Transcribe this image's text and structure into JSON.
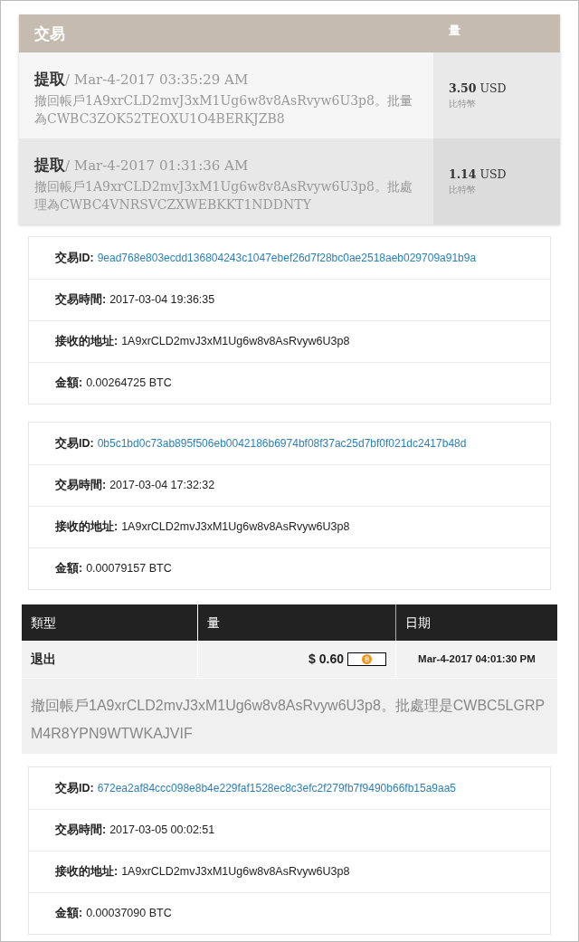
{
  "summary": {
    "columns": [
      "交易",
      "量"
    ],
    "rows": [
      {
        "type": "提取",
        "date": "/ Mar-4-2017 03:35:29 AM",
        "description": "撤回帳戶1A9xrCLD2mvJ3xM1Ug6w8v8AsRvyw6U3p8。批量為CWBC3ZOK52TEOXU1O4BERKJZB8",
        "amount": "3.50",
        "currency": "USD",
        "unit": "比特幣",
        "shaded": false
      },
      {
        "type": "提取",
        "date": "/ Mar-4-2017 01:31:36 AM",
        "description": "撤回帳戶1A9xrCLD2mvJ3xM1Ug6w8v8AsRvyw6U3p8。批處理為CWBC4VNRSVCZXWEBKKT1NDDNTY",
        "amount": "1.14",
        "currency": "USD",
        "unit": "比特幣",
        "shaded": true
      }
    ]
  },
  "details_1": [
    {
      "fields": [
        {
          "label": "交易ID:",
          "value": "9ead768e803ecdd136804243c1047ebef26d7f28bc0ae2518aeb029709a91b9a",
          "kind": "link"
        },
        {
          "label": "交易時間:",
          "value": "2017-03-04 19:36:35",
          "kind": "text"
        },
        {
          "label": "接收的地址:",
          "value": "1A9xrCLD2mvJ3xM1Ug6w8v8AsRvyw6U3p8",
          "kind": "text"
        },
        {
          "label": "金額:",
          "value": "0.00264725 BTC",
          "kind": "text"
        }
      ]
    },
    {
      "fields": [
        {
          "label": "交易ID:",
          "value": "0b5c1bd0c73ab895f506eb0042186b6974bf08f37ac25d7bf0f021dc2417b48d",
          "kind": "link"
        },
        {
          "label": "交易時間:",
          "value": "2017-03-04 17:32:32",
          "kind": "text"
        },
        {
          "label": "接收的地址:",
          "value": "1A9xrCLD2mvJ3xM1Ug6w8v8AsRvyw6U3p8",
          "kind": "text"
        },
        {
          "label": "金額:",
          "value": "0.00079157 BTC",
          "kind": "text"
        }
      ]
    }
  ],
  "table": {
    "columns": [
      "類型",
      "量",
      "日期"
    ],
    "rows": [
      {
        "type": "退出",
        "amount": "$ 0.60",
        "date": "Mar-4-2017 04:01:30 PM",
        "description": "撤回帳戶1A9xrCLD2mvJ3xM1Ug6w8v8AsRvyw6U3p8。批處理是CWBC5LGRPM4R8YPN9WTWKAJVIF"
      }
    ]
  },
  "details_2": [
    {
      "fields": [
        {
          "label": "交易ID:",
          "value": "672ea2af84ccc098e8b4e229faf1528ec8c3efc2f279fb7f9490b66fb15a9aa5",
          "kind": "link"
        },
        {
          "label": "交易時間:",
          "value": "2017-03-05 00:02:51",
          "kind": "text"
        },
        {
          "label": "接收的地址:",
          "value": "1A9xrCLD2mvJ3xM1Ug6w8v8AsRvyw6U3p8",
          "kind": "text"
        },
        {
          "label": "金額:",
          "value": "0.00037090 BTC",
          "kind": "text"
        }
      ]
    }
  ]
}
